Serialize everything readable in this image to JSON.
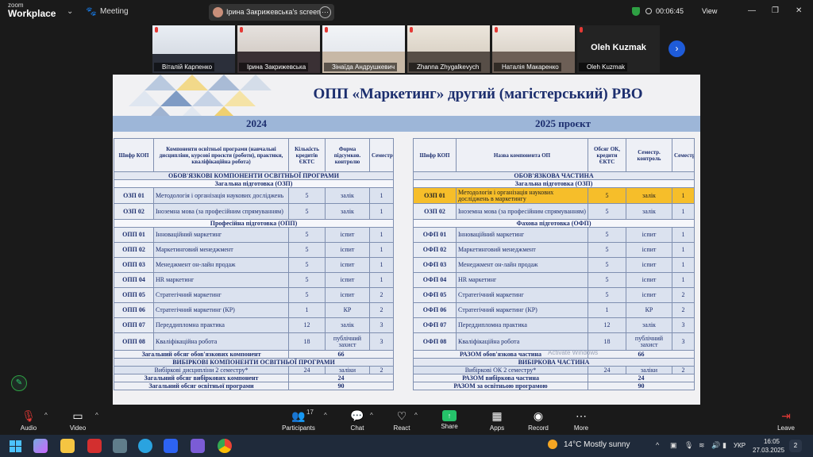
{
  "app": {
    "brand_line1": "zoom",
    "brand_line2": "Workplace",
    "meeting_label": "Meeting"
  },
  "share_pill": {
    "text": "Ірина Закрижевська's screen"
  },
  "timer": "00:06:45",
  "view_label": "View",
  "participants": [
    {
      "name": "Віталій Карпенко",
      "active": false,
      "video": true
    },
    {
      "name": "Ірина Закрижевська",
      "active": true,
      "video": true
    },
    {
      "name": "Зінаїда Андрушкевич",
      "active": false,
      "video": true
    },
    {
      "name": "Zhanna Zhygalkevych",
      "active": false,
      "video": true
    },
    {
      "name": "Наталія Макаренко",
      "active": false,
      "video": true
    },
    {
      "name": "Oleh Kuzmak",
      "active": false,
      "video": false
    }
  ],
  "slide": {
    "title": "ОПП «Маркетинг» другий (магістерський) РВО",
    "year_left": "2024",
    "year_right": "2025 проєкт",
    "left": {
      "headers": [
        "Шифр КОП",
        "Компоненти освітньої програми (навчальні дисципліни, курсові проєкти (роботи), практики, кваліфікаційна робота)",
        "Кількість кредитів ЄКТС",
        "Форма підсумков. контролю",
        "Семестр"
      ],
      "sec1": "ОБОВ'ЯЗКОВІ КОМПОНЕНТИ ОСВІТНЬОЇ ПРОГРАМИ",
      "sub1": "Загальна підготовка (ОЗП)",
      "rows1": [
        {
          "code": "ОЗП 01",
          "name": "Методологія і організація наукових досліджень",
          "cr": "5",
          "form": "залік",
          "sem": "1"
        },
        {
          "code": "ОЗП 02",
          "name": "Іноземна мова (за професійним спрямуванням)",
          "cr": "5",
          "form": "залік",
          "sem": "1"
        }
      ],
      "sub2": "Професійна підготовка (ОПП)",
      "rows2": [
        {
          "code": "ОПП 01",
          "name": "Інноваційний маркетинг",
          "cr": "5",
          "form": "іспит",
          "sem": "1"
        },
        {
          "code": "ОПП 02",
          "name": "Маркетинговий менеджмент",
          "cr": "5",
          "form": "іспит",
          "sem": "1"
        },
        {
          "code": "ОПП 03",
          "name": "Менеджмент он-лайн продаж",
          "cr": "5",
          "form": "іспит",
          "sem": "1"
        },
        {
          "code": "ОПП 04",
          "name": "HR маркетинг",
          "cr": "5",
          "form": "іспит",
          "sem": "1"
        },
        {
          "code": "ОПП 05",
          "name": "Стратегічний маркетинг",
          "cr": "5",
          "form": "іспит",
          "sem": "2"
        },
        {
          "code": "ОПП 06",
          "name": "Стратегічний маркетинг (КР)",
          "cr": "1",
          "form": "КР",
          "sem": "2"
        },
        {
          "code": "ОПП 07",
          "name": "Переддипломна практика",
          "cr": "12",
          "form": "залік",
          "sem": "3"
        },
        {
          "code": "ОПП 08",
          "name": "Кваліфікаційна робота",
          "cr": "18",
          "form": "публічний захист",
          "sem": "3"
        }
      ],
      "total_mand_label": "Загальний обсяг обов'язкових компонент",
      "total_mand": "66",
      "sec2": "ВИБІРКОВІ КОМПОНЕНТИ ОСВІТНЬОЇ ПРОГРАМИ",
      "elective": {
        "name": "Вибіркові дисципліни 2 семестру*",
        "cr": "24",
        "form": "заліки",
        "sem": "2"
      },
      "total_el_label": "Загальний обсяг вибіркових компонент",
      "total_el": "24",
      "total_label": "Загальний обсяг освітньої програми",
      "total": "90"
    },
    "right": {
      "headers": [
        "Шифр КОП",
        "Назва компонента ОП",
        "Обсяг ОК, кредити ЄКТС",
        "Семестр. контроль",
        "Семестр"
      ],
      "sec1": "ОБОВ'ЯЗКОВА ЧАСТИНА",
      "sub1": "Загальна підготовка (ОЗП)",
      "rows1": [
        {
          "code": "ОЗП 01",
          "name": "Методологія і організація наукових досліджень в маркетингу",
          "cr": "5",
          "form": "залік",
          "sem": "1",
          "hl": true
        },
        {
          "code": "ОЗП 02",
          "name": "Іноземна мова (за професійним спрямуванням)",
          "cr": "5",
          "form": "залік",
          "sem": "1",
          "hl": false
        }
      ],
      "sub2": "Фахова підготовка (ОФП)",
      "rows2": [
        {
          "code": "ОФП 01",
          "name": "Інноваційний маркетинг",
          "cr": "5",
          "form": "іспит",
          "sem": "1"
        },
        {
          "code": "ОФП 02",
          "name": "Маркетинговий менеджмент",
          "cr": "5",
          "form": "іспит",
          "sem": "1"
        },
        {
          "code": "ОФП 03",
          "name": "Менеджмент он-лайн продаж",
          "cr": "5",
          "form": "іспит",
          "sem": "1"
        },
        {
          "code": "ОФП 04",
          "name": "HR маркетинг",
          "cr": "5",
          "form": "іспит",
          "sem": "1"
        },
        {
          "code": "ОФП 05",
          "name": "Стратегічний маркетинг",
          "cr": "5",
          "form": "іспит",
          "sem": "2"
        },
        {
          "code": "ОФП 06",
          "name": "Стратегічний маркетинг (КР)",
          "cr": "1",
          "form": "КР",
          "sem": "2"
        },
        {
          "code": "ОФП 07",
          "name": "Переддипломна практика",
          "cr": "12",
          "form": "залік",
          "sem": "3"
        },
        {
          "code": "ОФП 08",
          "name": "Кваліфікаційна робота",
          "cr": "18",
          "form": "публічний захист",
          "sem": "3"
        }
      ],
      "total_mand_label": "РАЗОМ обов'язкова частина",
      "total_mand": "66",
      "sec2": "ВИБІРКОВА ЧАСТИНА",
      "elective": {
        "name": "Вибіркові ОК 2 семестру*",
        "cr": "24",
        "form": "заліки",
        "sem": "2"
      },
      "total_el_label": "РАЗОМ вибіркова частина",
      "total_el": "24",
      "total_label": "РАЗОМ за освітньою програмою",
      "total": "90"
    },
    "watermark": "Activate Windows"
  },
  "toolbar": {
    "audio": "Audio",
    "video": "Video",
    "participants": "Participants",
    "participants_count": "17",
    "chat": "Chat",
    "react": "React",
    "share": "Share",
    "apps": "Apps",
    "record": "Record",
    "more": "More",
    "leave": "Leave"
  },
  "taskbar": {
    "weather_temp": "14°C",
    "weather_text": "Mostly sunny",
    "lang": "УКР",
    "time": "16:05",
    "date": "27.03.2025",
    "notif": "2"
  },
  "colors": {
    "highlight": "#f6be2a",
    "navy": "#1c2e6e",
    "active_border": "#2ecc71",
    "zoom_blue": "#1e5bd8"
  }
}
